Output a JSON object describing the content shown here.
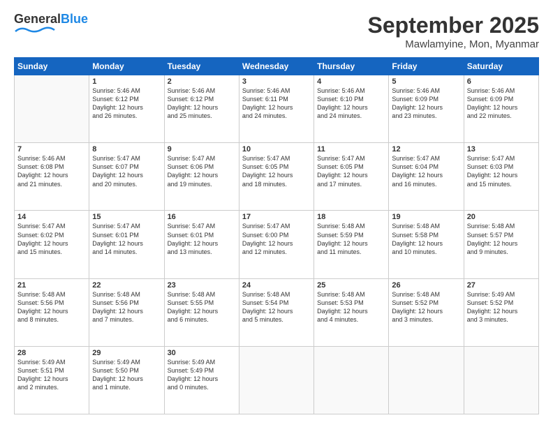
{
  "header": {
    "logo_general": "General",
    "logo_blue": "Blue",
    "month": "September 2025",
    "location": "Mawlamyine, Mon, Myanmar"
  },
  "days_of_week": [
    "Sunday",
    "Monday",
    "Tuesday",
    "Wednesday",
    "Thursday",
    "Friday",
    "Saturday"
  ],
  "weeks": [
    [
      {
        "day": "",
        "info": ""
      },
      {
        "day": "1",
        "info": "Sunrise: 5:46 AM\nSunset: 6:12 PM\nDaylight: 12 hours\nand 26 minutes."
      },
      {
        "day": "2",
        "info": "Sunrise: 5:46 AM\nSunset: 6:12 PM\nDaylight: 12 hours\nand 25 minutes."
      },
      {
        "day": "3",
        "info": "Sunrise: 5:46 AM\nSunset: 6:11 PM\nDaylight: 12 hours\nand 24 minutes."
      },
      {
        "day": "4",
        "info": "Sunrise: 5:46 AM\nSunset: 6:10 PM\nDaylight: 12 hours\nand 24 minutes."
      },
      {
        "day": "5",
        "info": "Sunrise: 5:46 AM\nSunset: 6:09 PM\nDaylight: 12 hours\nand 23 minutes."
      },
      {
        "day": "6",
        "info": "Sunrise: 5:46 AM\nSunset: 6:09 PM\nDaylight: 12 hours\nand 22 minutes."
      }
    ],
    [
      {
        "day": "7",
        "info": "Sunrise: 5:46 AM\nSunset: 6:08 PM\nDaylight: 12 hours\nand 21 minutes."
      },
      {
        "day": "8",
        "info": "Sunrise: 5:47 AM\nSunset: 6:07 PM\nDaylight: 12 hours\nand 20 minutes."
      },
      {
        "day": "9",
        "info": "Sunrise: 5:47 AM\nSunset: 6:06 PM\nDaylight: 12 hours\nand 19 minutes."
      },
      {
        "day": "10",
        "info": "Sunrise: 5:47 AM\nSunset: 6:05 PM\nDaylight: 12 hours\nand 18 minutes."
      },
      {
        "day": "11",
        "info": "Sunrise: 5:47 AM\nSunset: 6:05 PM\nDaylight: 12 hours\nand 17 minutes."
      },
      {
        "day": "12",
        "info": "Sunrise: 5:47 AM\nSunset: 6:04 PM\nDaylight: 12 hours\nand 16 minutes."
      },
      {
        "day": "13",
        "info": "Sunrise: 5:47 AM\nSunset: 6:03 PM\nDaylight: 12 hours\nand 15 minutes."
      }
    ],
    [
      {
        "day": "14",
        "info": "Sunrise: 5:47 AM\nSunset: 6:02 PM\nDaylight: 12 hours\nand 15 minutes."
      },
      {
        "day": "15",
        "info": "Sunrise: 5:47 AM\nSunset: 6:01 PM\nDaylight: 12 hours\nand 14 minutes."
      },
      {
        "day": "16",
        "info": "Sunrise: 5:47 AM\nSunset: 6:01 PM\nDaylight: 12 hours\nand 13 minutes."
      },
      {
        "day": "17",
        "info": "Sunrise: 5:47 AM\nSunset: 6:00 PM\nDaylight: 12 hours\nand 12 minutes."
      },
      {
        "day": "18",
        "info": "Sunrise: 5:48 AM\nSunset: 5:59 PM\nDaylight: 12 hours\nand 11 minutes."
      },
      {
        "day": "19",
        "info": "Sunrise: 5:48 AM\nSunset: 5:58 PM\nDaylight: 12 hours\nand 10 minutes."
      },
      {
        "day": "20",
        "info": "Sunrise: 5:48 AM\nSunset: 5:57 PM\nDaylight: 12 hours\nand 9 minutes."
      }
    ],
    [
      {
        "day": "21",
        "info": "Sunrise: 5:48 AM\nSunset: 5:56 PM\nDaylight: 12 hours\nand 8 minutes."
      },
      {
        "day": "22",
        "info": "Sunrise: 5:48 AM\nSunset: 5:56 PM\nDaylight: 12 hours\nand 7 minutes."
      },
      {
        "day": "23",
        "info": "Sunrise: 5:48 AM\nSunset: 5:55 PM\nDaylight: 12 hours\nand 6 minutes."
      },
      {
        "day": "24",
        "info": "Sunrise: 5:48 AM\nSunset: 5:54 PM\nDaylight: 12 hours\nand 5 minutes."
      },
      {
        "day": "25",
        "info": "Sunrise: 5:48 AM\nSunset: 5:53 PM\nDaylight: 12 hours\nand 4 minutes."
      },
      {
        "day": "26",
        "info": "Sunrise: 5:48 AM\nSunset: 5:52 PM\nDaylight: 12 hours\nand 3 minutes."
      },
      {
        "day": "27",
        "info": "Sunrise: 5:49 AM\nSunset: 5:52 PM\nDaylight: 12 hours\nand 3 minutes."
      }
    ],
    [
      {
        "day": "28",
        "info": "Sunrise: 5:49 AM\nSunset: 5:51 PM\nDaylight: 12 hours\nand 2 minutes."
      },
      {
        "day": "29",
        "info": "Sunrise: 5:49 AM\nSunset: 5:50 PM\nDaylight: 12 hours\nand 1 minute."
      },
      {
        "day": "30",
        "info": "Sunrise: 5:49 AM\nSunset: 5:49 PM\nDaylight: 12 hours\nand 0 minutes."
      },
      {
        "day": "",
        "info": ""
      },
      {
        "day": "",
        "info": ""
      },
      {
        "day": "",
        "info": ""
      },
      {
        "day": "",
        "info": ""
      }
    ]
  ]
}
